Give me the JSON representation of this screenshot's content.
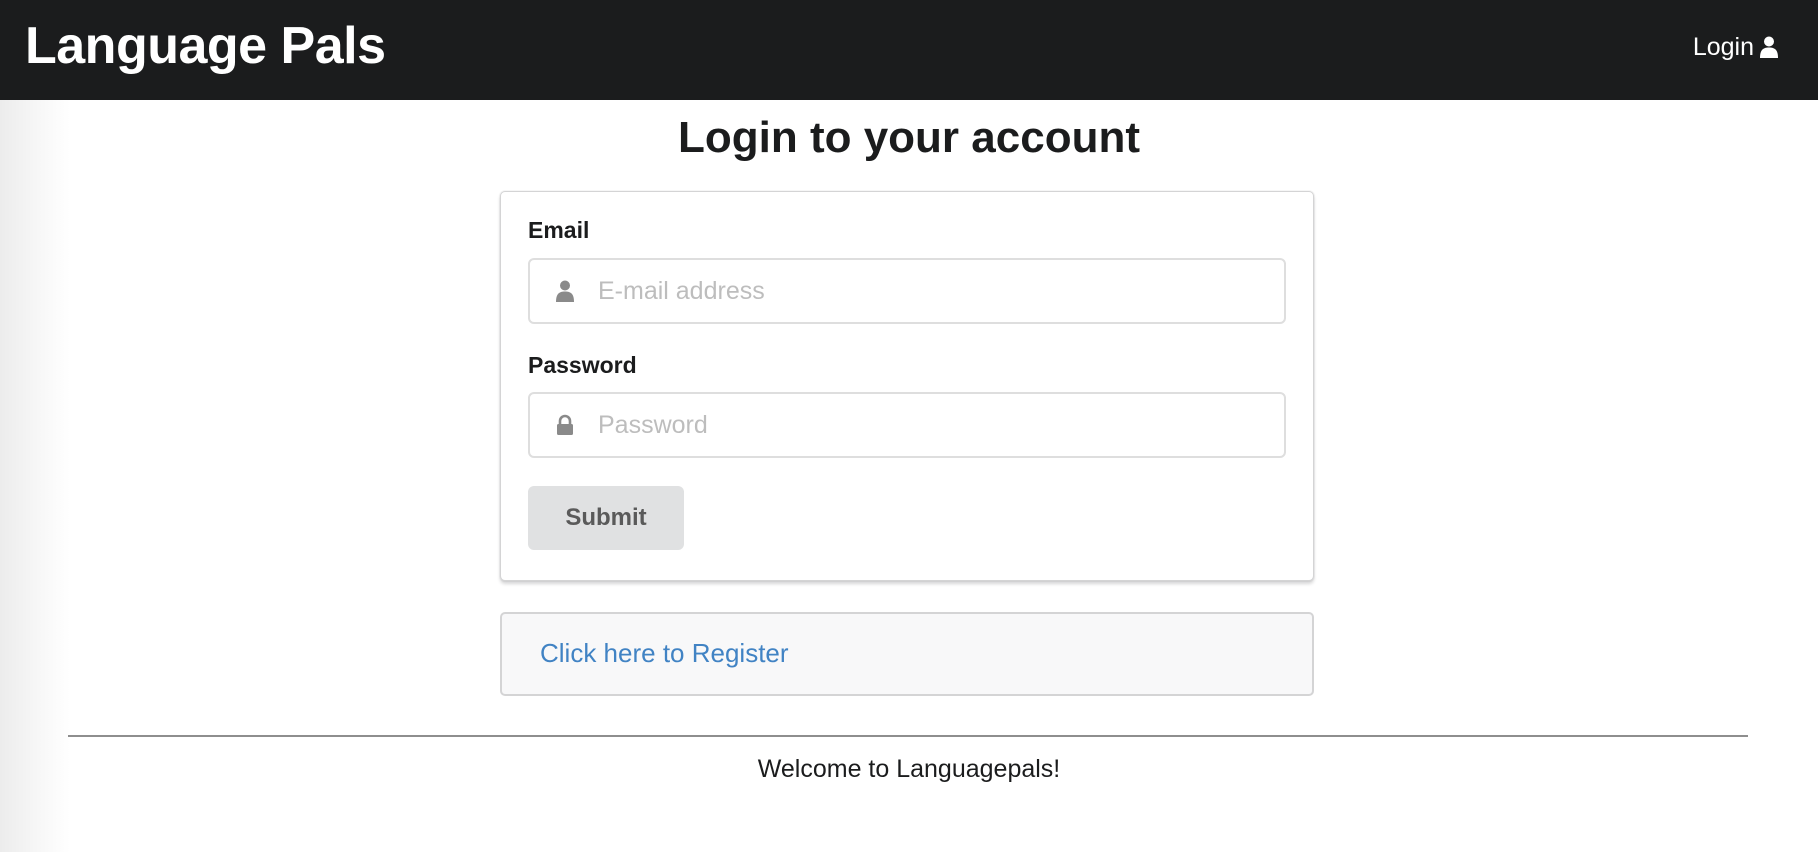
{
  "navbar": {
    "brand": "Language Pals",
    "login_label": "Login",
    "login_icon": "user-icon",
    "background": "#1b1c1d"
  },
  "main": {
    "title": "Login to your account",
    "form": {
      "email": {
        "label": "Email",
        "placeholder": "E-mail address",
        "value": "",
        "icon": "user-icon"
      },
      "password": {
        "label": "Password",
        "placeholder": "Password",
        "value": "",
        "icon": "lock-icon"
      },
      "submit_label": "Submit"
    },
    "register_link": "Click here to Register"
  },
  "footer": {
    "text": "Welcome to Languagepals!"
  },
  "colors": {
    "link": "#4183c4",
    "button_bg": "#e0e1e2",
    "button_text": "#5a5a5a"
  }
}
